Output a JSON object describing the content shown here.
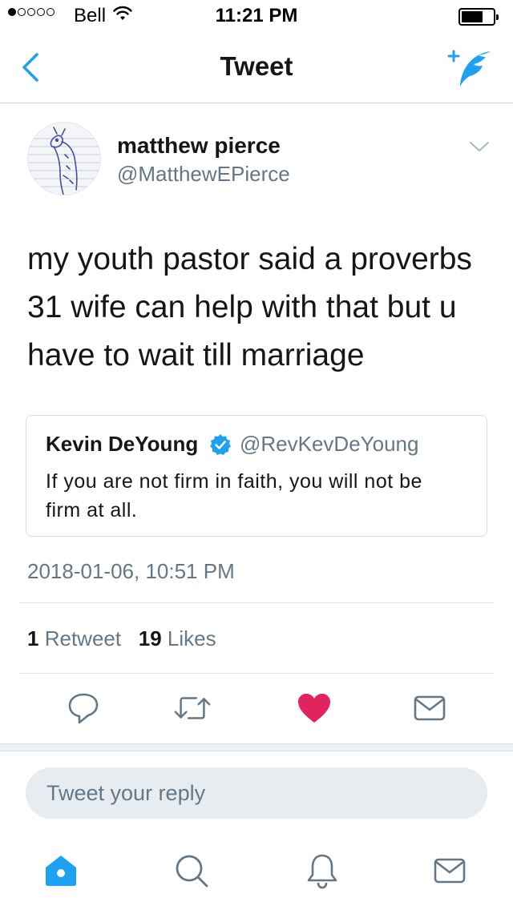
{
  "status_bar": {
    "carrier": "Bell",
    "time": "11:21 PM",
    "signal_bars_filled": 1,
    "signal_bars_total": 5,
    "battery_level": 0.6
  },
  "nav": {
    "title": "Tweet",
    "back_icon": "chevron-left-icon",
    "compose_icon": "compose-tweet-icon",
    "accent_color": "#1da1f2"
  },
  "tweet": {
    "author_name": "matthew pierce",
    "author_handle": "@MatthewEPierce",
    "text": "my youth pastor said a proverbs 31 wife can help with that but u have to wait till marriage",
    "timestamp": "2018-01-06, 10:51 PM",
    "retweet_count": "1",
    "retweet_label": "Retweet",
    "like_count": "19",
    "like_label": "Likes",
    "liked": true
  },
  "quoted_tweet": {
    "author_name": "Kevin DeYoung",
    "verified": true,
    "author_handle": "@RevKevDeYoung",
    "text": "If you are not firm in faith, you will not be firm at all."
  },
  "actions": {
    "reply_icon": "reply-icon",
    "retweet_icon": "retweet-icon",
    "like_icon": "heart-icon",
    "message_icon": "envelope-icon",
    "like_color": "#e0245e"
  },
  "reply_box": {
    "placeholder": "Tweet your reply"
  },
  "tab_bar": {
    "items": [
      "home-icon",
      "search-icon",
      "notifications-icon",
      "messages-icon"
    ],
    "active": "home-icon"
  }
}
